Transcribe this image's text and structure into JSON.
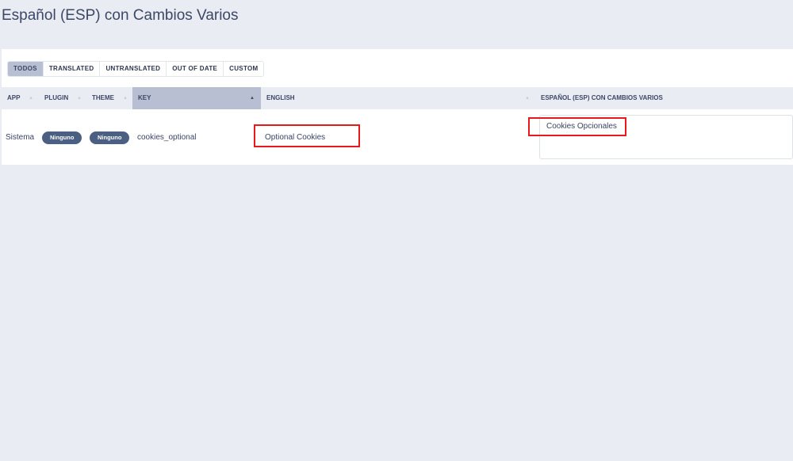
{
  "page": {
    "title": "Español (ESP) con Cambios Varios"
  },
  "filters": [
    {
      "label": "TODOS",
      "active": true
    },
    {
      "label": "TRANSLATED"
    },
    {
      "label": "UNTRANSLATED"
    },
    {
      "label": "OUT OF DATE"
    },
    {
      "label": "CUSTOM"
    }
  ],
  "columns": {
    "app": "APP",
    "plugin": "PLUGIN",
    "theme": "THEME",
    "key": "KEY",
    "english": "ENGLISH",
    "translation": "ESPAÑOL (ESP) CON CAMBIOS VARIOS"
  },
  "row": {
    "app": "Sistema",
    "plugin": "Ninguno",
    "theme": "Ninguno",
    "key": "cookies_optional",
    "english": "Optional Cookies",
    "translation": "Cookies Opcionales"
  },
  "colors": {
    "accent": "#b8bfd3",
    "pill": "#4b5f82",
    "highlight": "#e8191a"
  }
}
